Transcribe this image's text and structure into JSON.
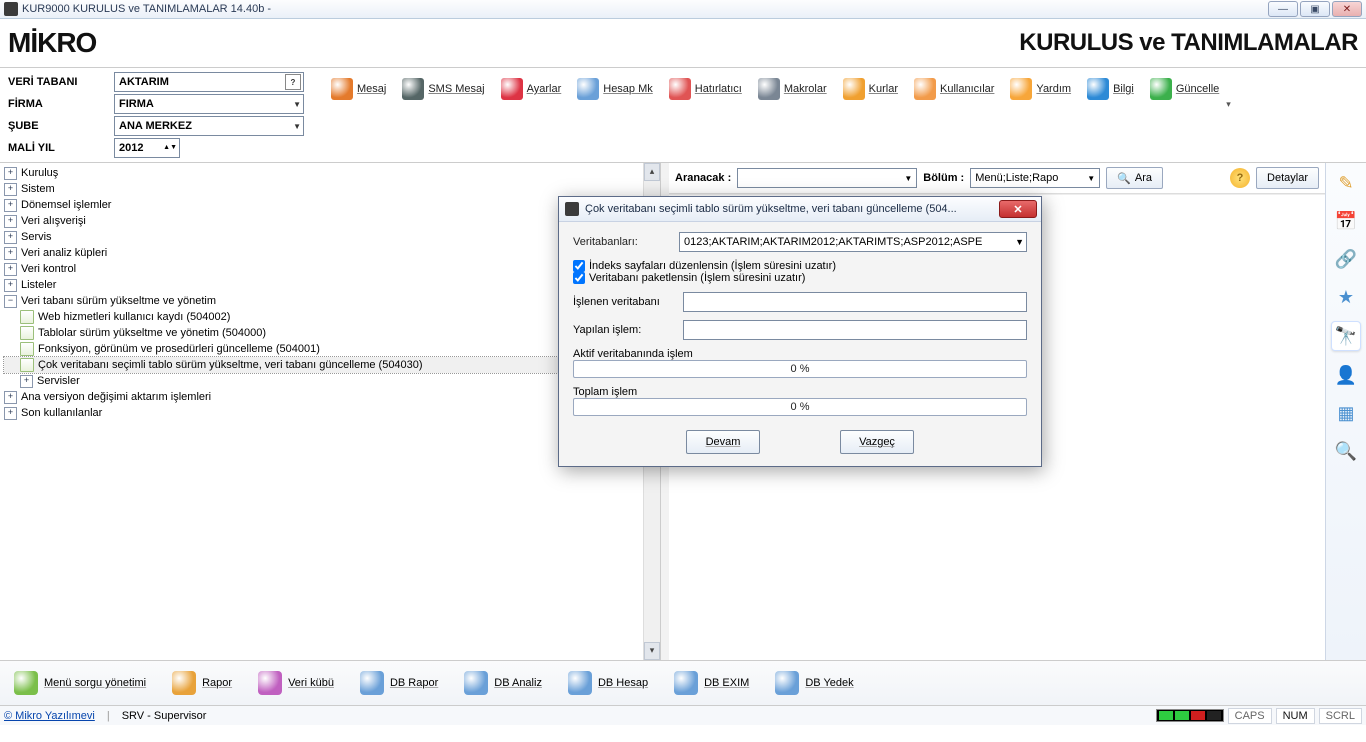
{
  "window": {
    "title": "KUR9000 KURULUS ve TANIMLAMALAR 14.40b -"
  },
  "brand": {
    "logo": "MİKRO",
    "app_title": "KURULUS ve TANIMLAMALAR"
  },
  "params": {
    "veritabani_label": "VERİ TABANI",
    "veritabani_value": "AKTARIM",
    "firma_label": "FİRMA",
    "firma_value": "FIRMA",
    "sube_label": "ŞUBE",
    "sube_value": "ANA MERKEZ",
    "maliyil_label": "MALİ YIL",
    "maliyil_value": "2012"
  },
  "toolbar": [
    {
      "label": "Mesaj",
      "color": "#e47a2c"
    },
    {
      "label": "SMS Mesaj",
      "color": "#566"
    },
    {
      "label": "Ayarlar",
      "color": "#d34"
    },
    {
      "label": "Hesap Mk",
      "color": "#6aa0d8"
    },
    {
      "label": "Hatırlatıcı",
      "color": "#e05454"
    },
    {
      "label": "Makrolar",
      "color": "#7a8694"
    },
    {
      "label": "Kurlar",
      "color": "#f0a030"
    },
    {
      "label": "Kullanıcılar",
      "color": "#f29b4a"
    },
    {
      "label": "Yardım",
      "color": "#f7a63a"
    },
    {
      "label": "Bilgi",
      "color": "#2d8ad6"
    },
    {
      "label": "Güncelle",
      "color": "#3cb04c"
    }
  ],
  "tree": {
    "nodes": [
      {
        "label": "Kuruluş",
        "exp": "+"
      },
      {
        "label": "Sistem",
        "exp": "+"
      },
      {
        "label": "Dönemsel işlemler",
        "exp": "+"
      },
      {
        "label": "Veri alışverişi",
        "exp": "+"
      },
      {
        "label": "Servis",
        "exp": "+"
      },
      {
        "label": "Veri analiz küpleri",
        "exp": "+"
      },
      {
        "label": "Veri kontrol",
        "exp": "+"
      },
      {
        "label": "Listeler",
        "exp": "+"
      },
      {
        "label": "Veri tabanı sürüm yükseltme ve yönetim",
        "exp": "-",
        "children": [
          {
            "label": "Web hizmetleri kullanıcı kaydı (504002)"
          },
          {
            "label": "Tablolar sürüm yükseltme ve yönetim (504000)"
          },
          {
            "label": "Fonksiyon, görünüm ve prosedürleri güncelleme (504001)"
          },
          {
            "label": "Çok veritabanı seçimli tablo sürüm yükseltme, veri tabanı güncelleme (504030)",
            "selected": true
          },
          {
            "label": "Servisler",
            "exp": "+"
          }
        ]
      },
      {
        "label": "Ana versiyon değişimi aktarım işlemleri",
        "exp": "+"
      },
      {
        "label": "Son kullanılanlar",
        "exp": "+"
      }
    ]
  },
  "search": {
    "aranacak_label": "Aranacak :",
    "bolum_label": "Bölüm :",
    "bolum_value": "Menü;Liste;Rapo",
    "ara_label": "Ara",
    "detaylar_label": "Detaylar"
  },
  "dialog": {
    "title": "Çok veritabanı seçimli tablo sürüm yükseltme, veri tabanı güncelleme (504...",
    "veritabanlari_label": "Veritabanları:",
    "veritabanlari_value": "0123;AKTARIM;AKTARIM2012;AKTARIMTS;ASP2012;ASPE",
    "chk1": "İndeks sayfaları düzenlensin (İşlem süresini uzatır)",
    "chk2": "Veritabanı paketlensin (İşlem süresini uzatır)",
    "islenen_label": "İşlenen veritabanı",
    "yapilan_label": "Yapılan işlem:",
    "aktif_label": "Aktif veritabanında işlem",
    "aktif_pct": "0 %",
    "toplam_label": "Toplam işlem",
    "toplam_pct": "0 %",
    "devam": "Devam",
    "vazgec": "Vazgeç"
  },
  "bottom": [
    {
      "label": "Menü sorgu yönetimi",
      "color": "#7bbf4a"
    },
    {
      "label": "Rapor",
      "color": "#e8a23a"
    },
    {
      "label": "Veri kübü",
      "color": "#c060c0"
    },
    {
      "label": "DB Rapor",
      "color": "#6aa0d8"
    },
    {
      "label": "DB Analiz",
      "color": "#6aa0d8"
    },
    {
      "label": "DB Hesap",
      "color": "#6aa0d8"
    },
    {
      "label": "DB EXIM",
      "color": "#6aa0d8"
    },
    {
      "label": "DB Yedek",
      "color": "#6aa0d8"
    }
  ],
  "status": {
    "copyright": "© Mikro Yazılımevi",
    "user": "SRV - Supervisor",
    "caps": "CAPS",
    "num": "NUM",
    "scrl": "SCRL",
    "leds": [
      "#2ecc40",
      "#2ecc40",
      "#d01f1f",
      "#222"
    ]
  },
  "right_icons": [
    "pencil",
    "calendar",
    "network",
    "star",
    "binoculars",
    "person",
    "grid",
    "search"
  ]
}
